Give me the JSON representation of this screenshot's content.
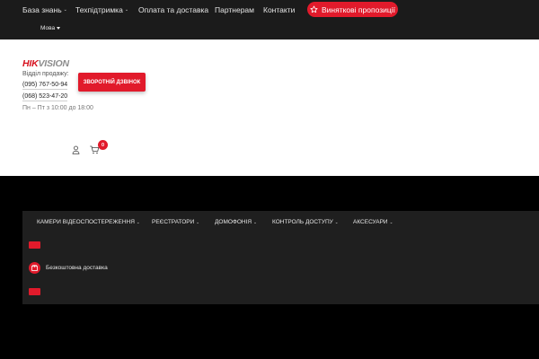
{
  "topbar": {
    "nav": [
      {
        "label": "База знань",
        "has_dropdown": true
      },
      {
        "label": "Техпідтримка",
        "has_dropdown": true
      },
      {
        "label": "Оплата та доставка",
        "has_dropdown": false
      },
      {
        "label": "Партнерам",
        "has_dropdown": false
      },
      {
        "label": "Контакти",
        "has_dropdown": false
      }
    ],
    "promo_label": "Виняткові пропозиції",
    "promo_icon": "star-icon",
    "language_label": "Мова",
    "background": "#1b1b1b"
  },
  "header": {
    "logo": {
      "part1": "HIK",
      "part2": "VISION",
      "color_primary": "#d7121f",
      "color_secondary": "#8c8c8c"
    },
    "sales_label": "Відділ продажу:",
    "phones": [
      "(095) 767-50-94",
      "(068) 523-47-20"
    ],
    "hours": "Пн – Пт з 10:00 до 18:00",
    "callback_label": "ЗВОРОТНІЙ ДЗВІНОК",
    "cart_count": "0",
    "icons": [
      "user-icon",
      "cart-icon"
    ]
  },
  "category_menu": {
    "items": [
      {
        "label": "КАМЕРИ ВІДЕОСПОСТЕРЕЖЕННЯ",
        "has_dropdown": true
      },
      {
        "label": "РЕЄСТРАТОРИ",
        "has_dropdown": true
      },
      {
        "label": "ДОМОФОНІЯ",
        "has_dropdown": true
      },
      {
        "label": "КОНТРОЛЬ ДОСТУПУ",
        "has_dropdown": true
      },
      {
        "label": "АКСЕСУАРИ",
        "has_dropdown": true
      }
    ],
    "features": [
      {
        "label": "Безкоштовна доставка",
        "icon": "delivery-box-icon"
      }
    ]
  },
  "colors": {
    "accent": "#e11a2b",
    "page_bg": "#000000",
    "panel_bg": "#1f1f1f",
    "header_bg": "#ffffff"
  }
}
